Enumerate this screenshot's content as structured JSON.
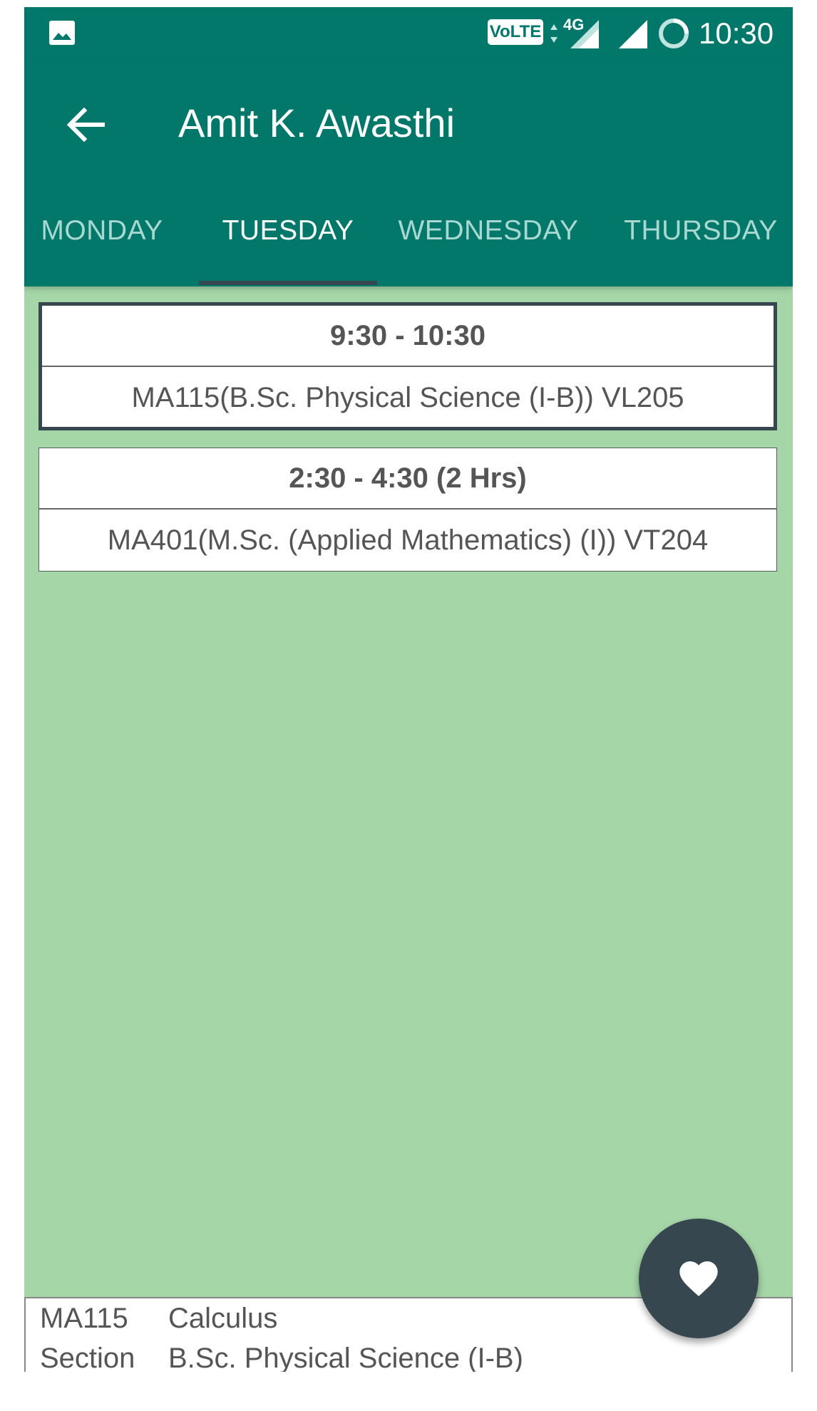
{
  "status_bar": {
    "volte_label": "VoLTE",
    "network_label": "4G",
    "time": "10:30"
  },
  "app_bar": {
    "title": "Amit K. Awasthi",
    "back_icon": "arrow-back-icon"
  },
  "tabs": [
    {
      "label": "MONDAY",
      "active": false
    },
    {
      "label": "TUESDAY",
      "active": true
    },
    {
      "label": "WEDNESDAY",
      "active": false
    },
    {
      "label": "THURSDAY",
      "active": false
    }
  ],
  "classes": [
    {
      "time": "9:30 - 10:30",
      "course": "MA115(B.Sc. Physical Science (I-B)) VL205",
      "selected": true
    },
    {
      "time": "2:30 - 4:30 (2 Hrs)",
      "course": "MA401(M.Sc. (Applied Mathematics) (I)) VT204",
      "selected": false
    }
  ],
  "info_panel": {
    "course_code": "MA115",
    "course_name": "Calculus",
    "section_label": "Section",
    "section_value": "B.Sc. Physical Science (I-B)"
  },
  "fab": {
    "icon": "heart-icon"
  },
  "colors": {
    "primary": "#02786a",
    "content_bg": "#a5d6a7",
    "accent": "#37474f",
    "inactive_tab": "#a9d8d0"
  }
}
